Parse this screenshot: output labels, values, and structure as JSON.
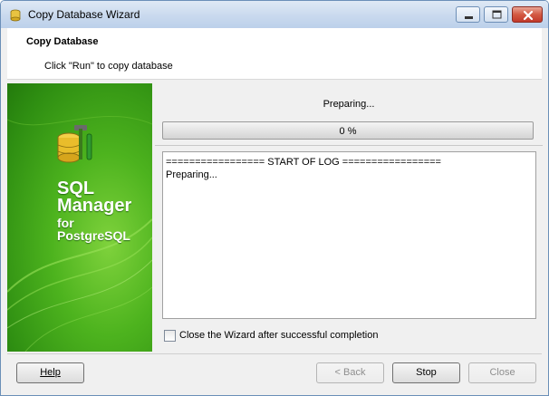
{
  "window": {
    "title": "Copy Database Wizard",
    "controls": {
      "minimize": "minimize-icon",
      "maximize": "maximize-icon",
      "close": "close-icon"
    }
  },
  "header": {
    "title": "Copy Database",
    "subtitle": "Click \"Run\" to copy database"
  },
  "banner": {
    "line1": "SQL",
    "line2": "Manager",
    "line3": "for",
    "line4": "PostgreSQL",
    "logo_icon": "database-tools-icon"
  },
  "progress": {
    "status": "Preparing...",
    "percent_label": "0 %",
    "value": 0
  },
  "log": {
    "lines": [
      "================= START OF LOG =================",
      "Preparing..."
    ]
  },
  "options": {
    "close_after_completion": "Close the Wizard after successful completion",
    "close_after_checked": false
  },
  "buttons": {
    "help": "Help",
    "back": "< Back",
    "stop": "Stop",
    "close": "Close"
  },
  "colors": {
    "banner_green": "#4db31e",
    "progress_fill": "#3fa53f",
    "titlebar": "#c9d9ee",
    "close_button": "#c2392a"
  }
}
